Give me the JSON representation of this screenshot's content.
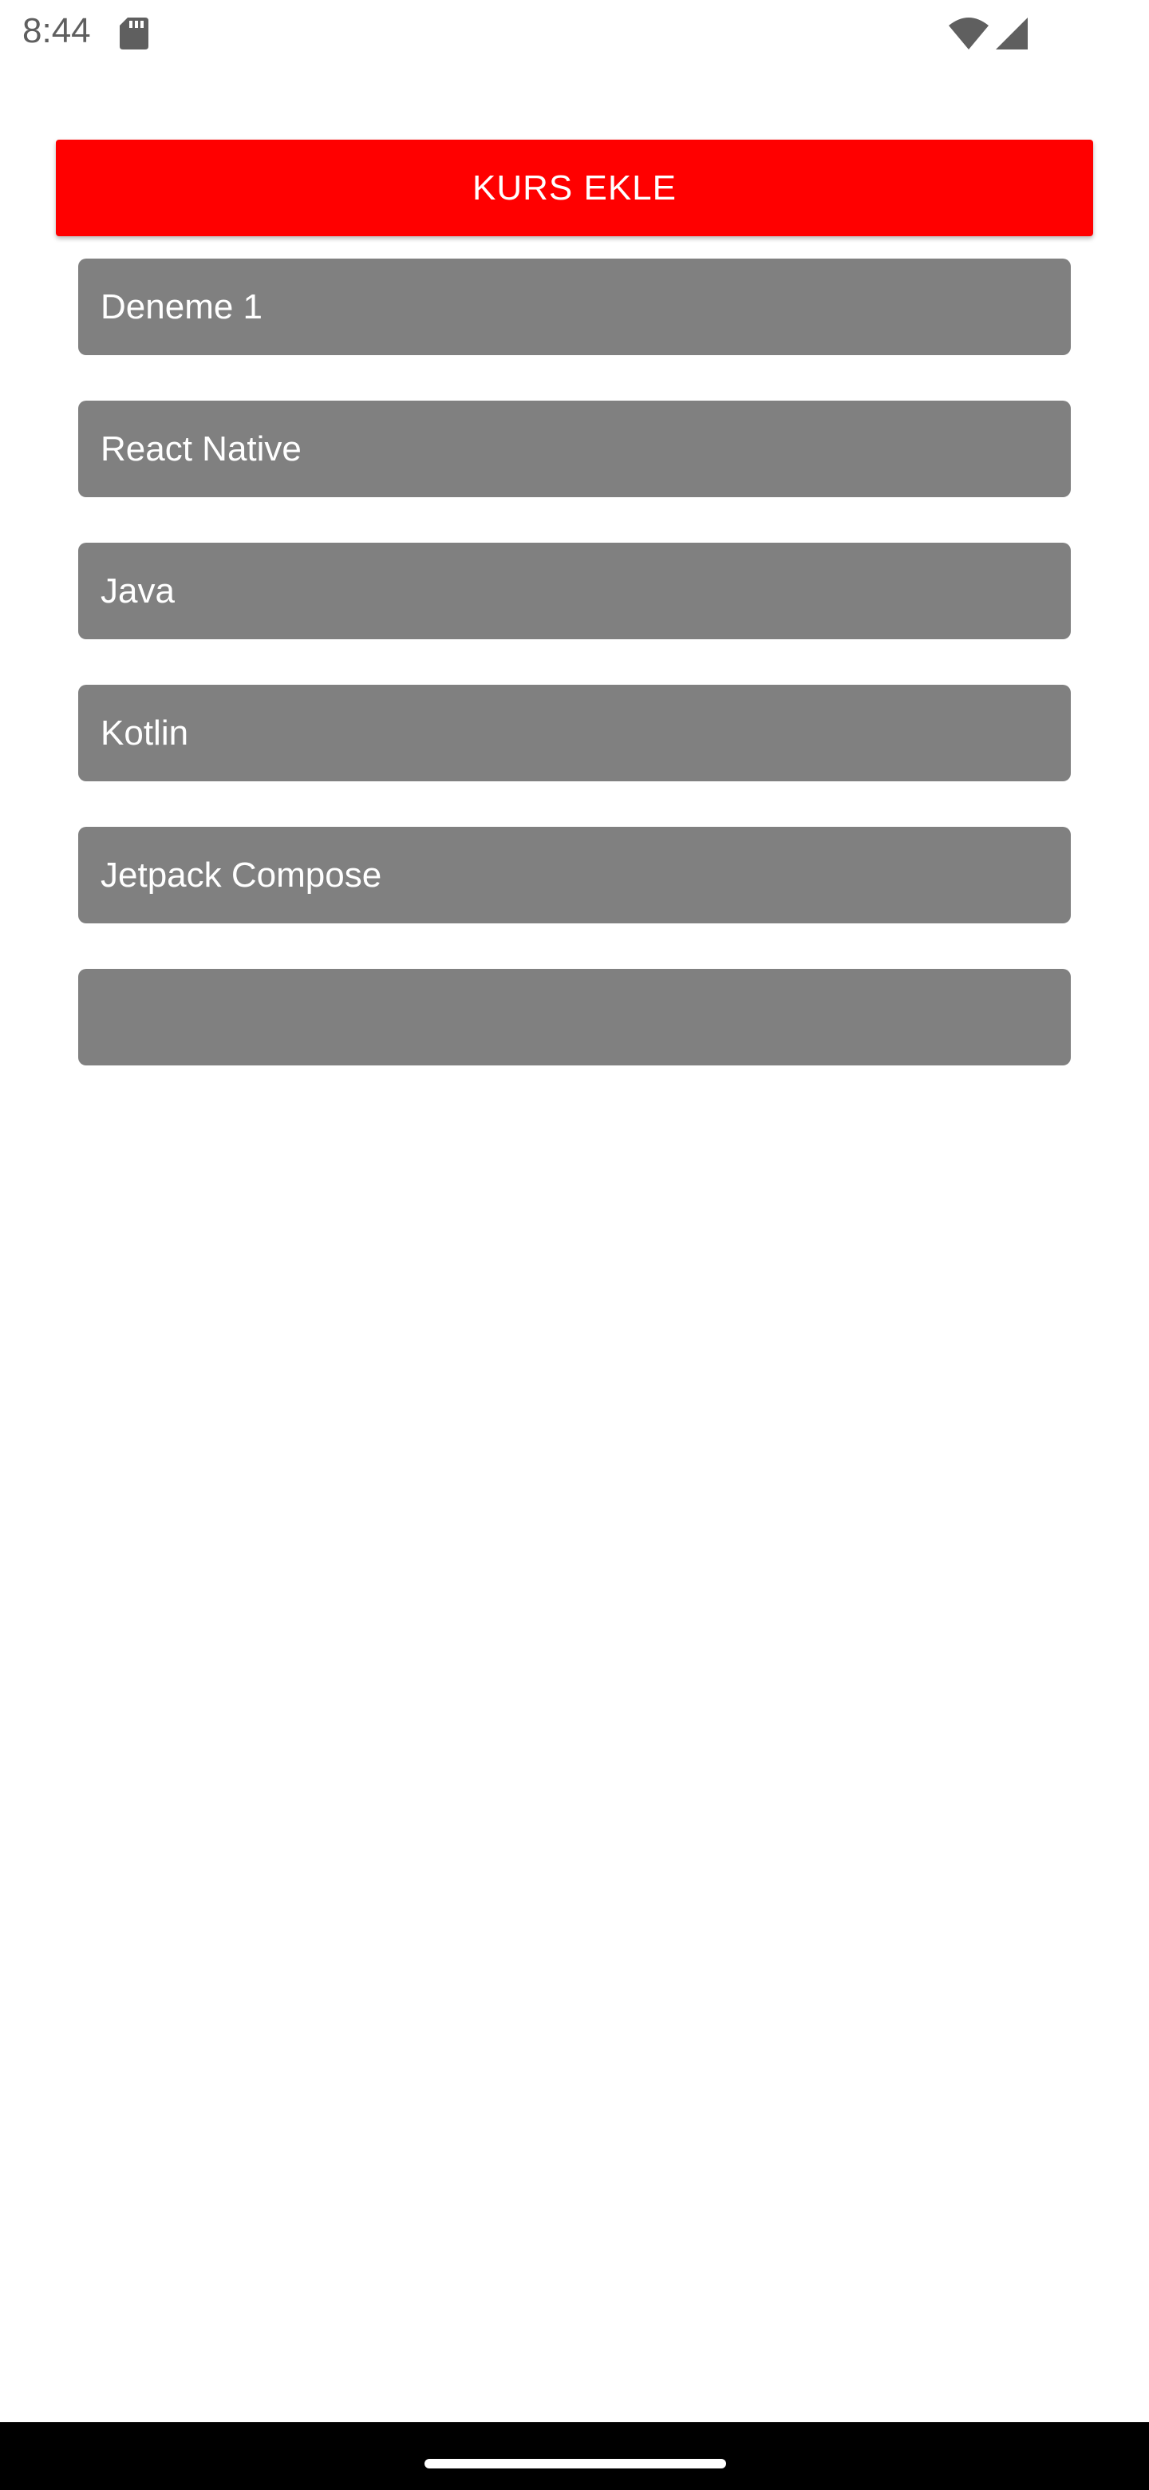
{
  "status_bar": {
    "time": "8:44",
    "icons": [
      "sd-card-icon",
      "wifi-icon",
      "cell-signal-icon"
    ]
  },
  "add_button": {
    "label": "KURS EKLE",
    "color": "#ff0000"
  },
  "courses": [
    {
      "title": "Deneme 1"
    },
    {
      "title": "React Native"
    },
    {
      "title": "Java"
    },
    {
      "title": "Kotlin"
    },
    {
      "title": "Jetpack Compose"
    },
    {
      "title": ""
    }
  ],
  "colors": {
    "course_background": "#808080",
    "course_text": "#ffffff",
    "nav_bar": "#000000"
  }
}
